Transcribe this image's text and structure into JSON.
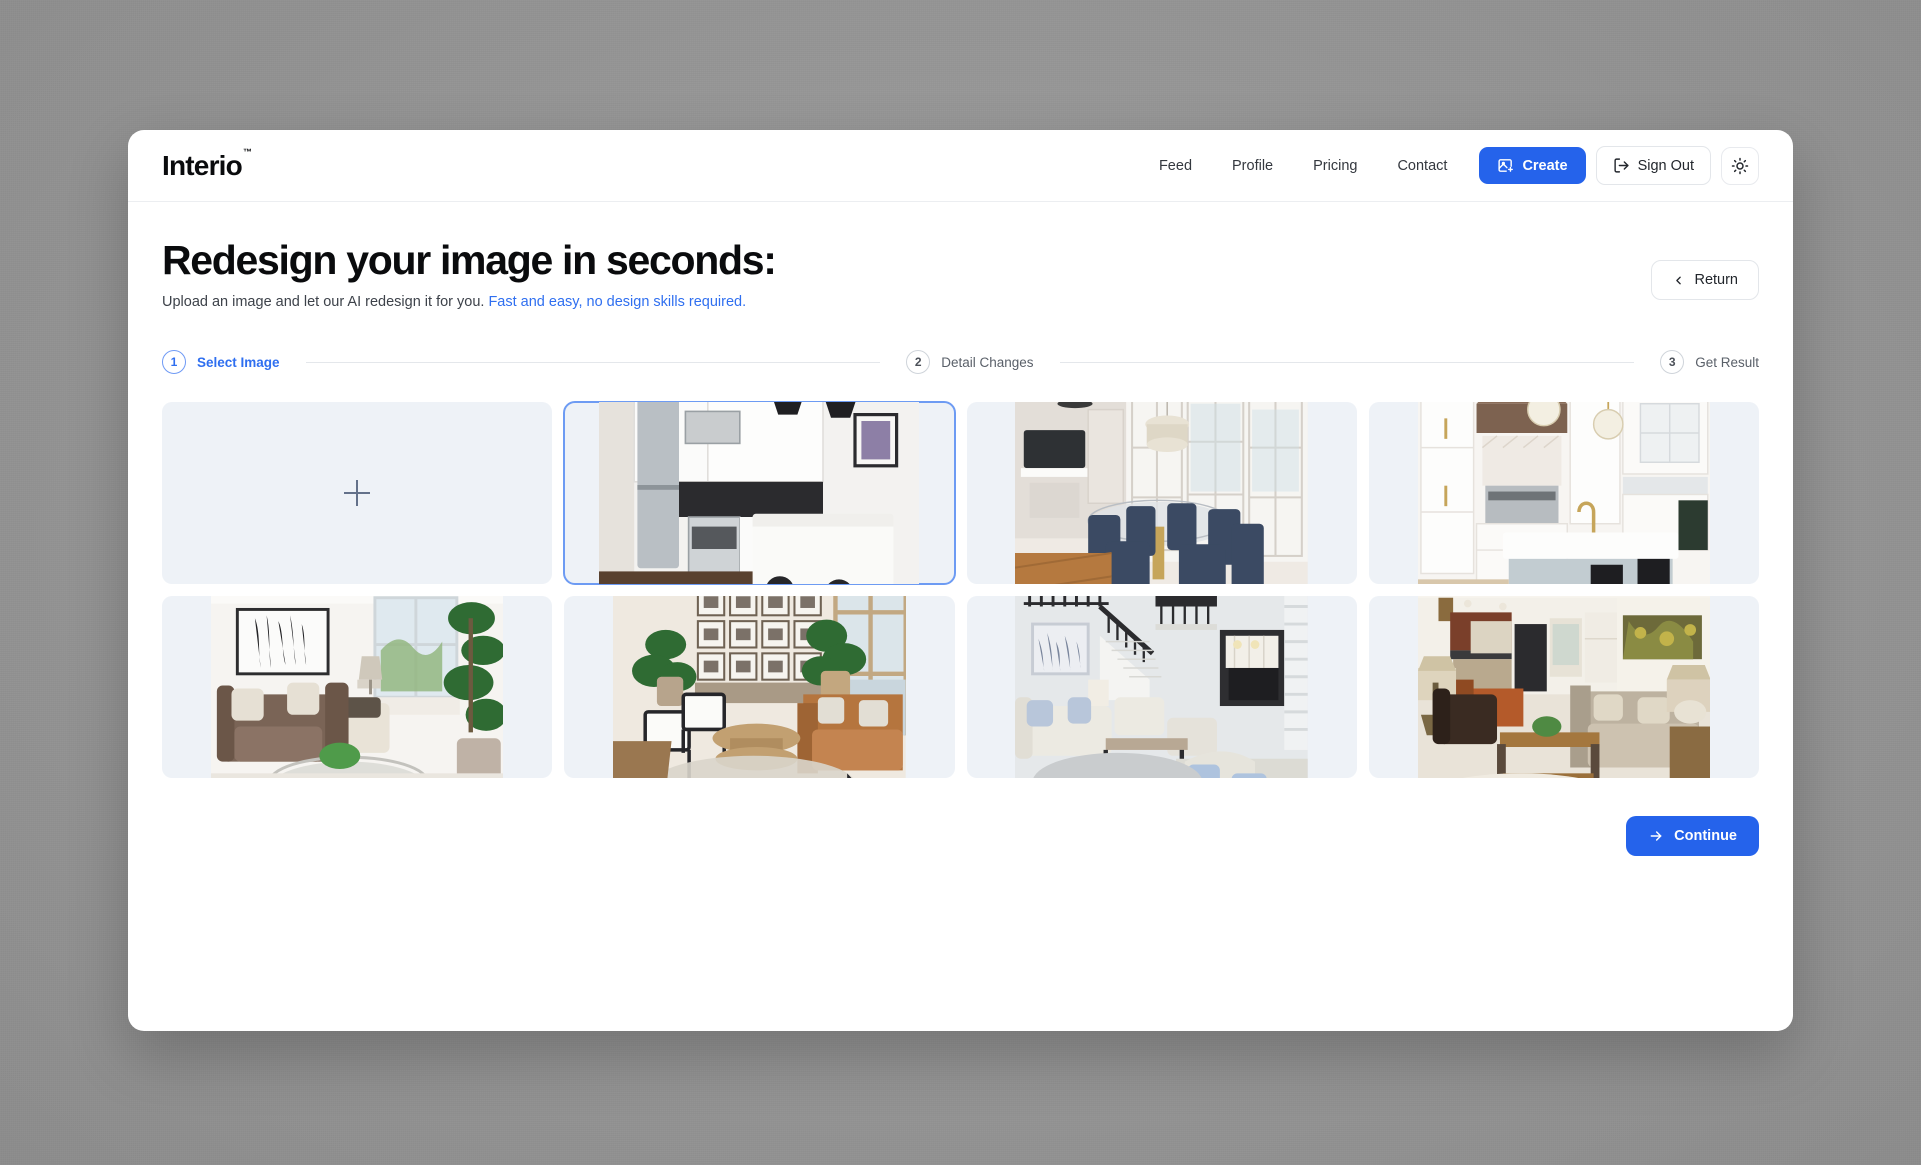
{
  "brand": {
    "name": "Interio",
    "trademark": "™"
  },
  "nav": {
    "links": [
      {
        "label": "Feed"
      },
      {
        "label": "Profile"
      },
      {
        "label": "Pricing"
      },
      {
        "label": "Contact"
      }
    ],
    "create_label": "Create",
    "create_icon": "image-sparkle-icon",
    "signout_label": "Sign Out",
    "signout_icon": "logout-icon",
    "theme_icon": "sun-icon"
  },
  "page": {
    "title": "Redesign your image in seconds:",
    "subtitle_plain": "Upload an image and let our AI redesign it for you.",
    "subtitle_accent": "Fast and easy, no design skills required.",
    "return_label": "Return",
    "return_icon": "chevron-left-icon"
  },
  "stepper": {
    "steps": [
      {
        "num": "1",
        "label": "Select Image",
        "active": true
      },
      {
        "num": "2",
        "label": "Detail Changes",
        "active": false
      },
      {
        "num": "3",
        "label": "Get Result",
        "active": false
      }
    ]
  },
  "gallery": {
    "upload_tile": {
      "name": "upload-image-tile",
      "icon": "plus-icon"
    },
    "items": [
      {
        "alt": "Modern white kitchen with dark backsplash, stainless steel appliances, black pendant lights and island with bar stools",
        "selected": true
      },
      {
        "alt": "Dining area with round glass table, navy upholstered chairs, crystal chandelier and French doors",
        "selected": false
      },
      {
        "alt": "Bright white kitchen with wood range hood, globe pendant lights and large island with black stools",
        "selected": false
      },
      {
        "alt": "Living room with brown velvet sofa, black and white abstract artwork, tall plant and glass coffee table",
        "selected": false
      },
      {
        "alt": "Sunlit living room with tan leather sofa, white armchairs, gallery photo wall and potted plants",
        "selected": false
      },
      {
        "alt": "Two-story living room with staircase, cream sofas, blue pillows and open kitchen beyond",
        "selected": false
      },
      {
        "alt": "Open plan living room with beige sofa, rustic wood coffee table, leather armchair and table lamps",
        "selected": false
      }
    ]
  },
  "footer": {
    "continue_label": "Continue",
    "continue_icon": "arrow-right-icon"
  },
  "colors": {
    "accent": "#2563eb",
    "accent_text": "#2f6ff0",
    "tile_bg": "#eef2f7",
    "selected_border": "#6d9bf3"
  }
}
